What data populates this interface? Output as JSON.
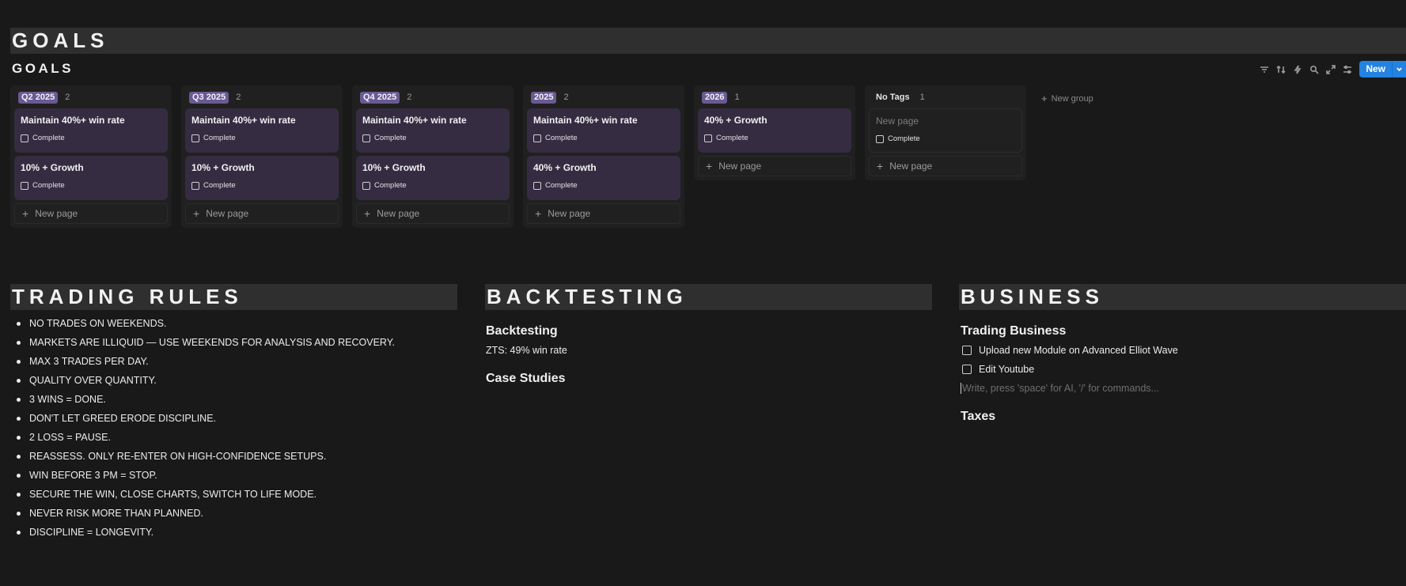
{
  "goals_banner": "GOALS",
  "database": {
    "title": "GOALS",
    "new_button": "New",
    "new_group": "New group",
    "columns": [
      {
        "tag": "Q2 2025",
        "count": "2",
        "cards": [
          {
            "title": "Maintain 40%+ win rate",
            "check": "Complete"
          },
          {
            "title": "10% + Growth",
            "check": "Complete"
          }
        ],
        "new_page": "New page"
      },
      {
        "tag": "Q3 2025",
        "count": "2",
        "cards": [
          {
            "title": "Maintain 40%+ win rate",
            "check": "Complete"
          },
          {
            "title": "10% + Growth",
            "check": "Complete"
          }
        ],
        "new_page": "New page"
      },
      {
        "tag": "Q4 2025",
        "count": "2",
        "cards": [
          {
            "title": "Maintain 40%+ win rate",
            "check": "Complete"
          },
          {
            "title": "10% + Growth",
            "check": "Complete"
          }
        ],
        "new_page": "New page"
      },
      {
        "tag": "2025",
        "count": "2",
        "cards": [
          {
            "title": "Maintain 40%+ win rate",
            "check": "Complete"
          },
          {
            "title": "40% + Growth",
            "check": "Complete"
          }
        ],
        "new_page": "New page"
      },
      {
        "tag": "2026",
        "count": "1",
        "cards": [
          {
            "title": "40% + Growth",
            "check": "Complete"
          }
        ],
        "new_page": "New page"
      },
      {
        "tag": "No Tags",
        "count": "1",
        "cards": [
          {
            "title": "New page",
            "check": "Complete"
          }
        ],
        "new_page": "New page"
      }
    ]
  },
  "trading_rules": {
    "heading": "TRADING RULES",
    "items": [
      "NO TRADES ON WEEKENDS.",
      "MARKETS ARE ILLIQUID — USE WEEKENDS FOR ANALYSIS AND RECOVERY.",
      "MAX 3 TRADES PER DAY.",
      "QUALITY OVER QUANTITY.",
      "3 WINS = DONE.",
      "DON'T LET GREED ERODE DISCIPLINE.",
      "2 LOSS = PAUSE.",
      "REASSESS. ONLY RE-ENTER ON HIGH-CONFIDENCE SETUPS.",
      "WIN BEFORE 3 PM = STOP.",
      "SECURE THE WIN, CLOSE CHARTS, SWITCH TO LIFE MODE.",
      "NEVER RISK MORE THAN PLANNED.",
      "DISCIPLINE = LONGEVITY."
    ]
  },
  "backtesting": {
    "heading": "BACKTESTING",
    "subheading": "Backtesting",
    "line": "ZTS: 49% win rate",
    "case_studies": "Case Studies"
  },
  "business": {
    "heading": "BUSINESS",
    "subheading": "Trading Business",
    "todos": [
      "Upload new Module on Advanced Elliot Wave",
      "Edit Youtube"
    ],
    "placeholder": "Write, press 'space' for AI, '/' for commands...",
    "taxes": "Taxes"
  }
}
